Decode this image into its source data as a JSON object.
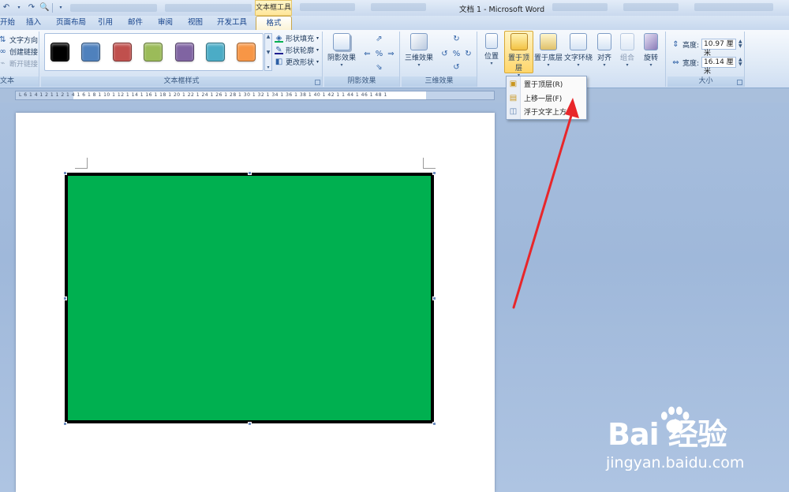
{
  "titlebar": {
    "context_tools_title": "文本框工具",
    "document_title": "文档 1 - Microsoft Word",
    "quick_access": [
      "undo-icon",
      "redo-icon",
      "print-preview-icon"
    ]
  },
  "tabs": [
    {
      "label": "开始"
    },
    {
      "label": "插入"
    },
    {
      "label": "页面布局"
    },
    {
      "label": "引用"
    },
    {
      "label": "邮件"
    },
    {
      "label": "审阅"
    },
    {
      "label": "视图"
    },
    {
      "label": "开发工具"
    },
    {
      "label": "格式",
      "active": true
    }
  ],
  "ribbon": {
    "text_group": {
      "label": "文本",
      "text_direction": "文字方向",
      "create_link": "创建链接",
      "break_link": "断开链接"
    },
    "textbox_styles": {
      "label": "文本框样式",
      "swatches": [
        "#000000",
        "#4f81bd",
        "#c0504d",
        "#9bbb59",
        "#8064a2",
        "#4bacc6",
        "#f79646"
      ],
      "shape_fill": "形状填充",
      "shape_outline": "形状轮廓",
      "change_shape": "更改形状"
    },
    "shadow_effects": {
      "label": "阴影效果",
      "button": "阴影效果"
    },
    "three_d_effects": {
      "label": "三维效果",
      "button": "三维效果"
    },
    "arrange": {
      "position": "位置",
      "bring_to_front": "置于顶层",
      "send_to_back": "置于底层",
      "text_wrapping": "文字环绕",
      "align": "对齐",
      "group": "组合",
      "rotate": "旋转"
    },
    "size": {
      "label": "大小",
      "height_label": "高度:",
      "height_value": "10.97 厘米",
      "width_label": "宽度:",
      "width_value": "16.14 厘米"
    }
  },
  "ruler": {
    "marks": "L 6 1 4 1 2 1   1 2 1 4 1 6 1 8 1 10 1 12 1 14 1 16 1 18 1 20 1 22 1 24 1 26 1 28 1 30 1 32 1 34 1 36 1 38 1 40 1 42 1   1 44 1 46 1 48 1"
  },
  "dropdown": {
    "items": [
      {
        "label": "置于顶层(R)",
        "icon": "bring-to-front-icon"
      },
      {
        "label": "上移一层(F)",
        "icon": "bring-forward-icon"
      },
      {
        "label": "浮于文字上方(",
        "icon": "in-front-of-text-icon"
      }
    ]
  },
  "document": {
    "textbox_fill": "#00b050",
    "textbox_border": "#000000"
  },
  "annotation": {
    "arrow_color": "#e8262a"
  },
  "watermark": {
    "logo": "Bai 经验",
    "url": "jingyan.baidu.com"
  }
}
